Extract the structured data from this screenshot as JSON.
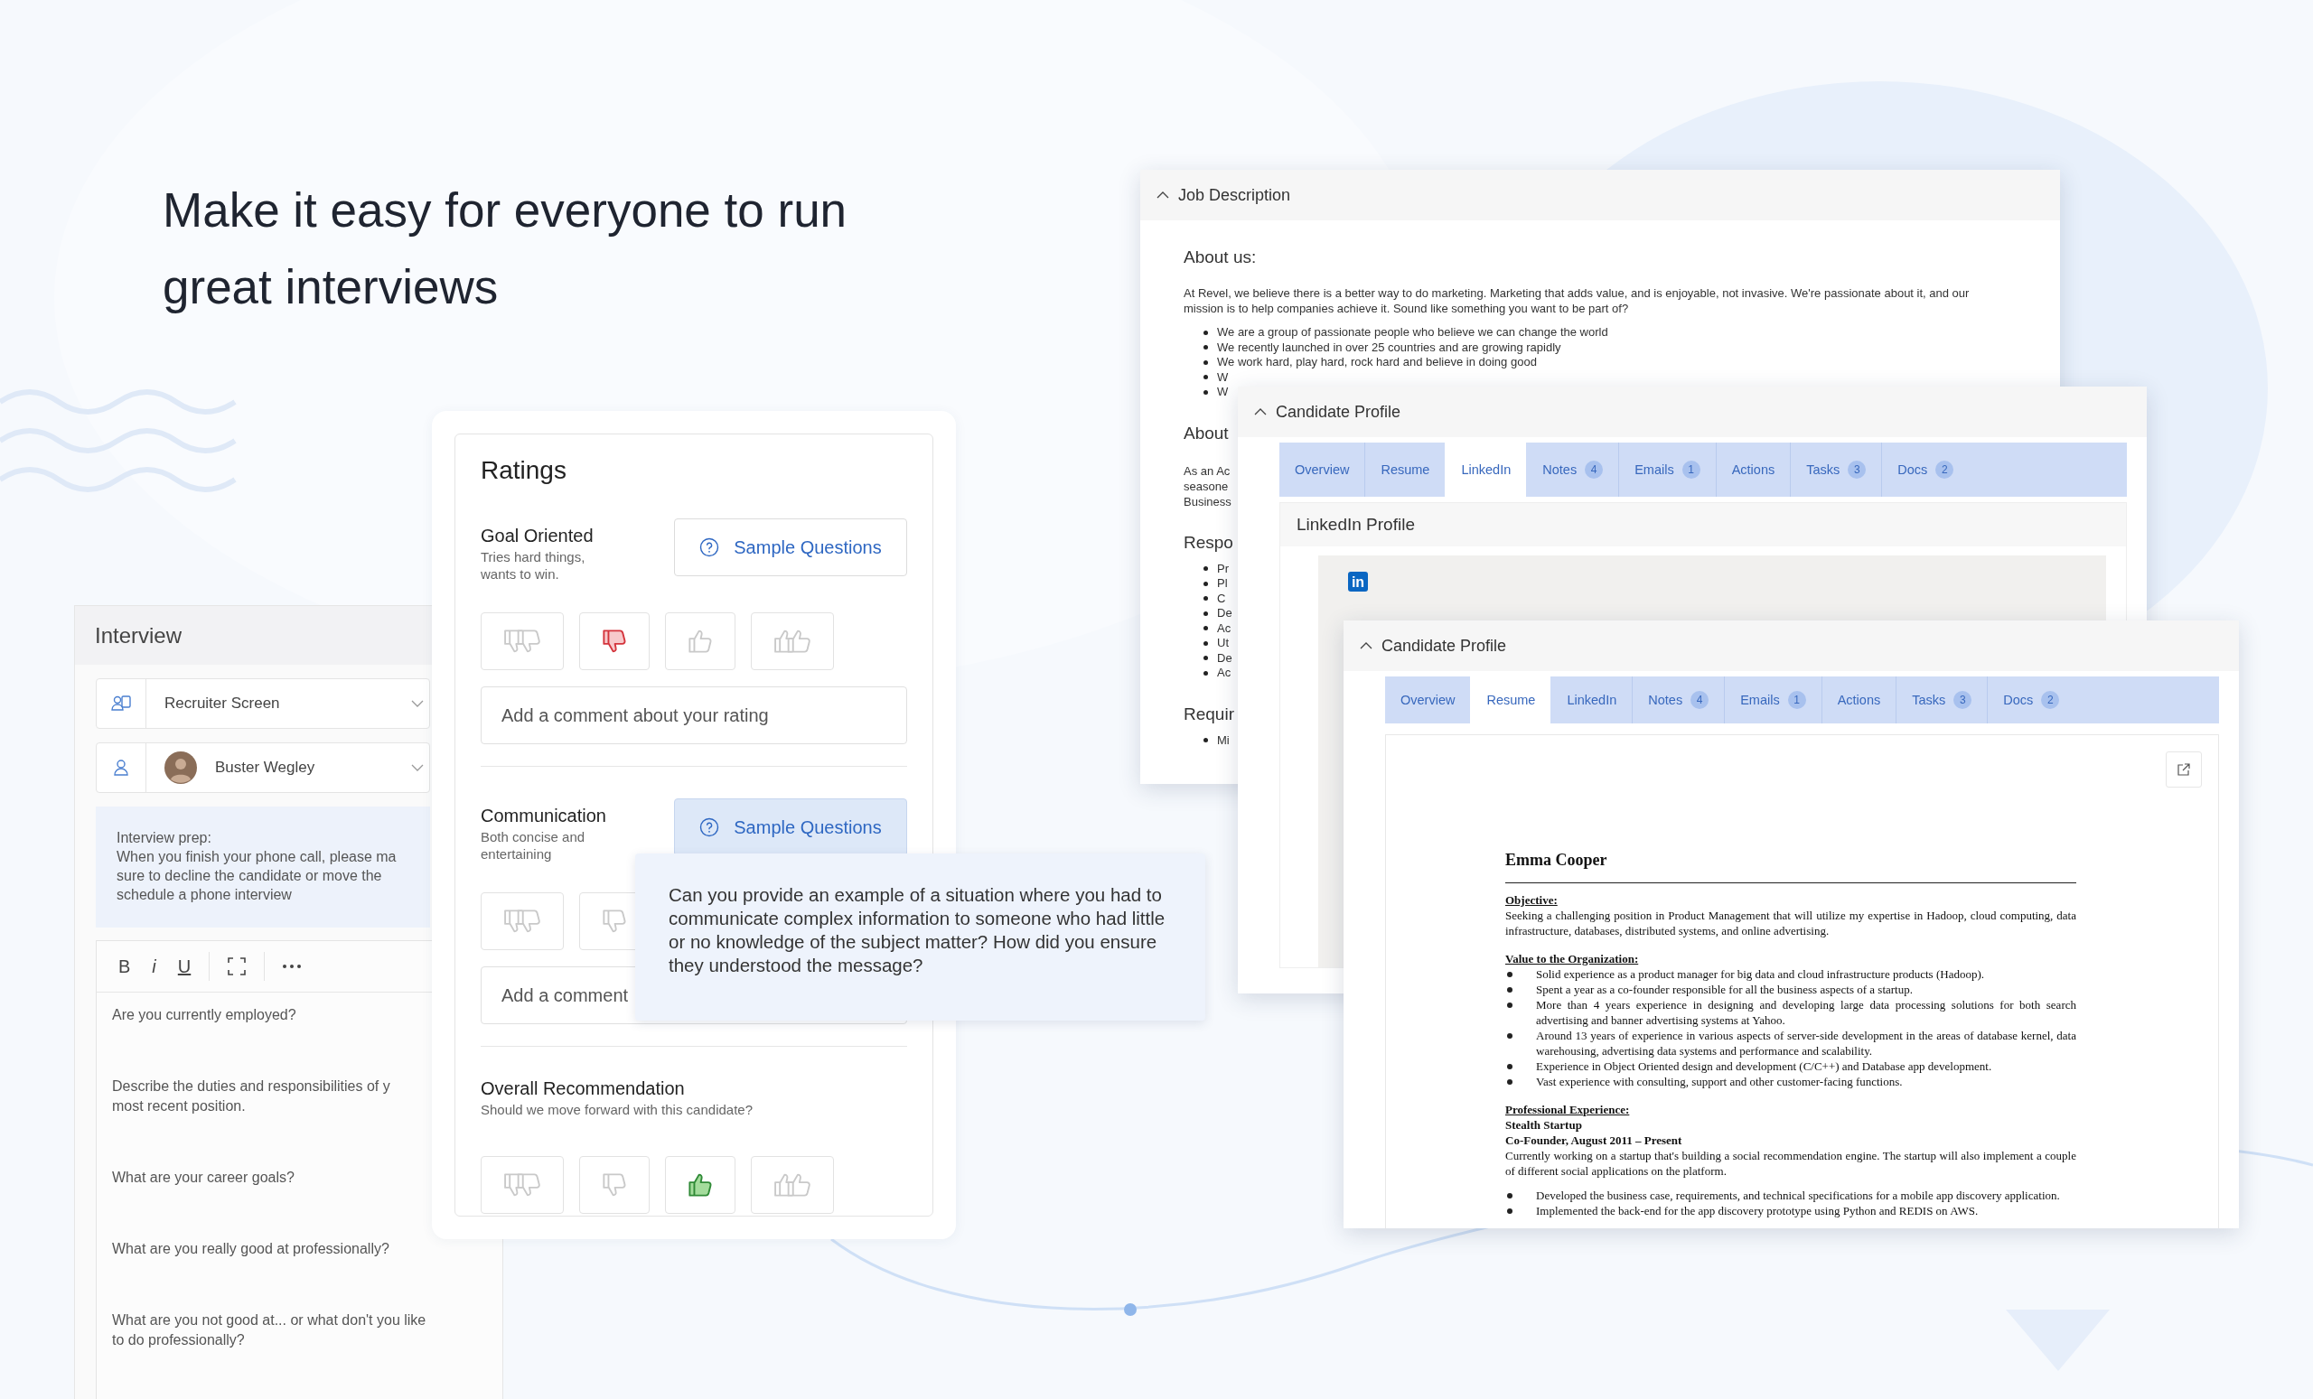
{
  "headline": "Make it easy for everyone to run great interviews",
  "interview": {
    "title": "Interview",
    "selects": [
      {
        "kind": "stage",
        "value": "Recruiter Screen"
      },
      {
        "kind": "interviewer",
        "value": "Buster Wegley"
      }
    ],
    "prep": [
      "Interview prep:",
      "When you finish your phone call, please ma",
      "sure to decline the candidate or move the",
      "schedule a phone interview"
    ],
    "toolbar": [
      {
        "kind": "bold",
        "label": "B"
      },
      {
        "kind": "italic",
        "label": "i"
      },
      {
        "kind": "underline",
        "label": "U"
      }
    ],
    "questions": [
      {
        "lines": [
          "Are you currently employed?"
        ]
      },
      {
        "lines": [
          "Describe the duties and responsibilities of y",
          "most recent position."
        ]
      },
      {
        "lines": [
          "What are your career goals?"
        ]
      },
      {
        "lines": [
          "What are you really good at professionally?"
        ]
      },
      {
        "lines": [
          "What are you not good at... or what don't you like",
          "to do professionally?"
        ]
      }
    ]
  },
  "ratings": {
    "title": "Ratings",
    "criteria": [
      {
        "title": "Goal Oriented",
        "description": "Tries hard things, wants to win.",
        "sample_button": {
          "label": "Sample Questions",
          "selected": false
        },
        "thumbs": [
          {
            "kind": "strong-no",
            "selected": false
          },
          {
            "kind": "no",
            "selected": true
          },
          {
            "kind": "yes",
            "selected": false
          },
          {
            "kind": "strong-yes",
            "selected": false
          }
        ],
        "comment_placeholder": "Add a comment about your rating"
      },
      {
        "title": "Communication",
        "description": "Both concise and entertaining",
        "sample_button": {
          "label": "Sample Questions",
          "selected": true
        },
        "thumbs": [
          {
            "kind": "strong-no",
            "selected": false
          },
          {
            "kind": "no",
            "selected": false
          }
        ],
        "comment_placeholder": "Add a comment"
      },
      {
        "title": "Overall Recommendation",
        "description": "Should we move forward with this candidate?",
        "thumbs": [
          {
            "kind": "strong-no",
            "selected": false
          },
          {
            "kind": "no",
            "selected": false
          },
          {
            "kind": "yes",
            "selected": true
          },
          {
            "kind": "strong-yes",
            "selected": false
          }
        ]
      }
    ]
  },
  "tooltip": {
    "text": "Can you provide an example of a situation where you had to communicate complex information to someone who had little or no knowledge of the subject matter? How did you ensure they understood the message?"
  },
  "job_description": {
    "title": "Job Description",
    "blocks": [
      {
        "kind": "heading",
        "text": "About us:"
      },
      {
        "kind": "paragraph",
        "text": "At Revel, we believe there is a better way to do marketing. Marketing that adds value, and is enjoyable, not invasive. We're passionate about it, and our mission is to help companies achieve it. Sound like something you want to be part of?"
      },
      {
        "kind": "bullets",
        "items": [
          "We are a group of passionate people who believe we can change the world",
          "We recently launched in over 25 countries and are growing rapidly",
          "We work hard, play hard, rock hard and believe in doing good",
          "W",
          "W"
        ]
      },
      {
        "kind": "heading",
        "text": "About"
      },
      {
        "kind": "lines",
        "lines": [
          "As an Ac",
          "seasone",
          "Business"
        ]
      },
      {
        "kind": "heading",
        "text": "Respo"
      },
      {
        "kind": "bullets",
        "items": [
          "Pr",
          "Pl",
          "C",
          "De",
          "Ac",
          "Ut",
          "De",
          "Ac"
        ]
      },
      {
        "kind": "heading",
        "text": "Requir"
      },
      {
        "kind": "bullets",
        "items": [
          "Mi"
        ]
      }
    ]
  },
  "candidate_profiles": [
    {
      "title": "Candidate Profile",
      "tabs": [
        {
          "label": "Overview",
          "selected": false
        },
        {
          "label": "Resume",
          "selected": false
        },
        {
          "label": "LinkedIn",
          "selected": true
        },
        {
          "label": "Notes",
          "count": "4",
          "selected": false
        },
        {
          "label": "Emails",
          "count": "1",
          "selected": false
        },
        {
          "label": "Actions",
          "selected": false
        },
        {
          "label": "Tasks",
          "count": "3",
          "selected": false
        },
        {
          "label": "Docs",
          "count": "2",
          "selected": false
        }
      ],
      "view": {
        "kind": "linkedin",
        "title": "LinkedIn Profile",
        "logo_text": "in"
      }
    },
    {
      "title": "Candidate Profile",
      "tabs": [
        {
          "label": "Overview",
          "selected": false
        },
        {
          "label": "Resume",
          "selected": true
        },
        {
          "label": "LinkedIn",
          "selected": false
        },
        {
          "label": "Notes",
          "count": "4",
          "selected": false
        },
        {
          "label": "Emails",
          "count": "1",
          "selected": false
        },
        {
          "label": "Actions",
          "selected": false
        },
        {
          "label": "Tasks",
          "count": "3",
          "selected": false
        },
        {
          "label": "Docs",
          "count": "2",
          "selected": false
        }
      ],
      "view": {
        "kind": "resume",
        "name": "Emma Cooper",
        "sections": [
          {
            "heading": "Objective:",
            "blocks": [
              {
                "kind": "paragraph",
                "text": "Seeking a challenging position in Product Management that will utilize my expertise in Hadoop, cloud computing, data infrastructure, databases, distributed systems, and online advertising."
              }
            ]
          },
          {
            "heading": "Value to the Organization:",
            "blocks": [
              {
                "kind": "bullets",
                "items": [
                  "Solid experience as a product manager for big data and cloud infrastructure products (Hadoop).",
                  "Spent a year as a co-founder responsible for all the business aspects of a startup.",
                  "More than 4 years experience in designing and developing large data processing solutions for both search advertising and banner advertising systems at Yahoo.",
                  "Around 13 years of experience in various aspects of server-side development in the areas of database kernel, data warehousing, advertising data systems and performance and scalability.",
                  "Experience in Object Oriented design and development (C/C++) and Database app development.",
                  "Vast experience with consulting, support and other customer-facing functions."
                ]
              }
            ]
          },
          {
            "heading": "Professional Experience:",
            "blocks": [
              {
                "kind": "title",
                "text": "Stealth Startup"
              },
              {
                "kind": "title",
                "text": "Co-Founder, August 2011 – Present"
              },
              {
                "kind": "paragraph",
                "text": "Currently working on a startup that's building a social recommendation engine. The startup will also implement a couple of different social applications on the platform."
              },
              {
                "kind": "bullets",
                "items": [
                  "Developed the business case, requirements, and technical specifications for a mobile app discovery application.",
                  "Implemented the back-end for the app discovery prototype using Python and REDIS on AWS."
                ]
              }
            ]
          }
        ]
      }
    }
  ]
}
